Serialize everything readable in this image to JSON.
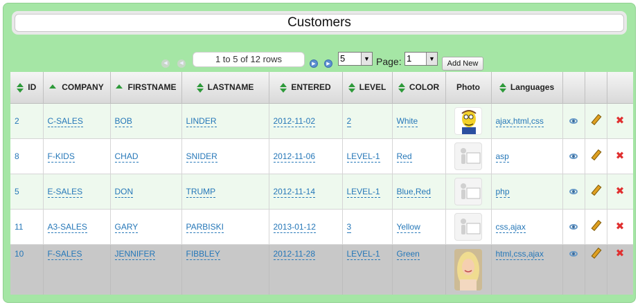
{
  "title": "Customers",
  "pager": {
    "rows_info": "1 to 5 of 12 rows",
    "page_size": "5",
    "page_label": "Page:",
    "page_value": "1",
    "add_new": "Add New"
  },
  "columns": {
    "id": "ID",
    "company": "COMPANY",
    "firstname": "FIRSTNAME",
    "lastname": "LASTNAME",
    "entered": "ENTERED",
    "level": "LEVEL",
    "color": "COLOR",
    "photo": "Photo",
    "languages": "Languages"
  },
  "rows": [
    {
      "id": "2",
      "company": "C-SALES",
      "firstname": "BOB",
      "lastname": "LINDER",
      "entered": "2012-11-02",
      "level": "2",
      "color": "White",
      "photo": "cartoon",
      "languages": "ajax,html,css"
    },
    {
      "id": "8",
      "company": "F-KIDS",
      "firstname": "CHAD",
      "lastname": "SNIDER",
      "entered": "2012-11-06",
      "level": "LEVEL-1",
      "color": "Red",
      "photo": "placeholder",
      "languages": "asp"
    },
    {
      "id": "5",
      "company": "E-SALES",
      "firstname": "DON",
      "lastname": "TRUMP",
      "entered": "2012-11-14",
      "level": "LEVEL-1",
      "color": "Blue,Red",
      "photo": "placeholder",
      "languages": "php"
    },
    {
      "id": "11",
      "company": "A3-SALES",
      "firstname": "GARY",
      "lastname": "PARBISKI",
      "entered": "2013-01-12",
      "level": "3",
      "color": "Yellow",
      "photo": "placeholder",
      "languages": "css,ajax"
    },
    {
      "id": "10",
      "company": "F-SALES",
      "firstname": "JENNIFER",
      "lastname": "FIBBLEY",
      "entered": "2012-11-28",
      "level": "LEVEL-1",
      "color": "Green",
      "photo": "woman",
      "languages": "html,css,ajax"
    }
  ],
  "colors": {
    "frame": "#a5e6a5",
    "row_alt": "#eef9ee",
    "row_selected": "#c8c8c8",
    "link": "#2577b8",
    "sort_arrow": "#2e9a3a",
    "delete": "#e03030"
  },
  "icons": [
    "first-page-icon",
    "prev-page-icon",
    "next-page-icon",
    "last-page-icon",
    "sort-icon",
    "view-icon",
    "edit-icon",
    "delete-icon"
  ]
}
